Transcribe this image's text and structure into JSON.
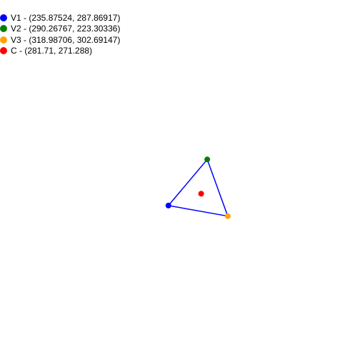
{
  "legend": {
    "items": [
      {
        "label": "V1 - (235.87524, 287.86917)",
        "color": "#0000ff"
      },
      {
        "label": "V2 - (290.26767, 223.30336)",
        "color": "#008000"
      },
      {
        "label": "V3 - (318.98706, 302.69147)",
        "color": "#ffa500"
      },
      {
        "label": "C - (281.71, 271.288)",
        "color": "#ff0000"
      }
    ]
  },
  "triangle": {
    "edge_color": "#0000ff",
    "points": [
      {
        "id": "V1",
        "x": 235.87524,
        "y": 287.86917,
        "color": "#0000ff"
      },
      {
        "id": "V2",
        "x": 290.26767,
        "y": 223.30336,
        "color": "#008000"
      },
      {
        "id": "V3",
        "x": 318.98706,
        "y": 302.69147,
        "color": "#ffa500"
      },
      {
        "id": "C",
        "x": 281.71,
        "y": 271.288,
        "color": "#ff0000"
      }
    ]
  }
}
